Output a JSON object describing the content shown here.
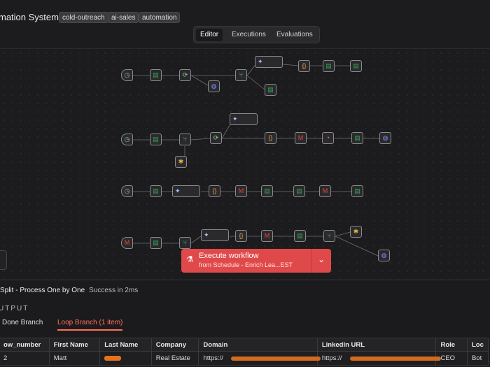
{
  "header": {
    "workflow_title": "mation System",
    "tags": [
      "cold-outreach",
      "ai-sales",
      "automation"
    ]
  },
  "view_tabs": [
    "Editor",
    "Executions",
    "Evaluations"
  ],
  "active_view_tab": "Editor",
  "execute_button": {
    "label": "Execute workflow",
    "sublabel": "from Schedule - Enrich Lea...EST"
  },
  "node_run": {
    "name": "Split - Process One by One",
    "status": "Success in 2ms"
  },
  "output_label": "UTPUT",
  "branch_tabs": [
    {
      "label": "Done Branch",
      "selected": false
    },
    {
      "label": "Loop Branch (1 item)",
      "selected": true
    }
  ],
  "table": {
    "columns": [
      "ow_number",
      "First Name",
      "Last Name",
      "Company",
      "Domain",
      "LinkedIn URL",
      "Role",
      "Loc"
    ],
    "rows": [
      [
        "2",
        "Matt",
        "",
        "Real Estate",
        "https://",
        "https://",
        "CEO",
        "Bot"
      ]
    ]
  },
  "colors": {
    "accent": "#ff6d5a",
    "execute": "#e0494a",
    "canvas": "#1c1c1e"
  }
}
